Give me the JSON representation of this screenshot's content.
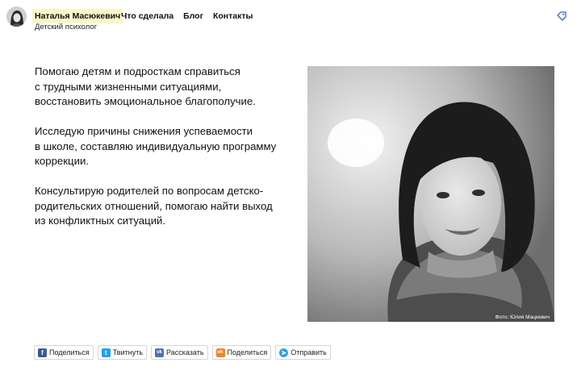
{
  "header": {
    "brand_name": "Наталья Масюкевич",
    "subtitle": "Детский психолог",
    "nav": [
      {
        "label": "Что сделала"
      },
      {
        "label": "Блог"
      },
      {
        "label": "Контакты"
      }
    ],
    "tag_icon": "tag-icon"
  },
  "intro": {
    "paragraphs": [
      "Помогаю детям и подросткам справиться\nс трудными жизненными ситуациями,\nвосстановить эмоциональное благополучие.",
      "Исследую причины снижения успеваемости\nв школе, составляю индивидуальную программу\nкоррекции.",
      "Консультирую родителей по вопросам детско-\nродительских отношений, помогаю найти выход\nиз конфликтных ситуаций."
    ]
  },
  "photo": {
    "credit": "Фото: Юлия Мацкевич"
  },
  "share": [
    {
      "label": "Поделиться",
      "icon": "facebook-icon",
      "color": "#3b5998",
      "glyph": "f"
    },
    {
      "label": "Твитнуть",
      "icon": "twitter-icon",
      "color": "#1da1f2",
      "glyph": "t"
    },
    {
      "label": "Рассказать",
      "icon": "vk-icon",
      "color": "#4a76a8",
      "glyph": "vk"
    },
    {
      "label": "Поделиться",
      "icon": "odnoklassniki-icon",
      "color": "#f58220",
      "glyph": "ok"
    },
    {
      "label": "Отправить",
      "icon": "telegram-icon",
      "color": "#2aa3df",
      "glyph": "➤"
    }
  ]
}
